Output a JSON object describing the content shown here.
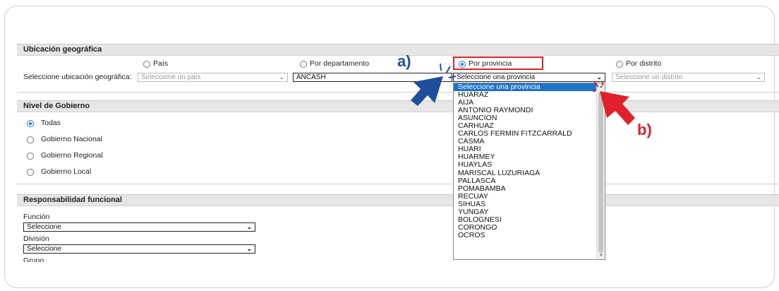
{
  "ubicacion": {
    "header": "Ubicación geográfica",
    "radios": [
      {
        "label": "País",
        "checked": false
      },
      {
        "label": "Por departamento",
        "checked": false
      },
      {
        "label": "Por provincia",
        "checked": true
      },
      {
        "label": "Por distrito",
        "checked": false
      }
    ],
    "prompt": "Seleccione ubicación geográfica:",
    "pais_select": "Seleccione un país",
    "departamento_select": "ANCASH",
    "provincia_select": "Seleccione una provincia",
    "distrito_select": "Seleccione un distrito"
  },
  "provincia_options": [
    "Seleccione una provincia",
    "HUARAZ",
    "AIJA",
    "ANTONIO RAYMONDI",
    "ASUNCION",
    "CARHUAZ",
    "CARLOS FERMIN FITZCARRALD",
    "CASMA",
    "HUARI",
    "HUARMEY",
    "HUAYLAS",
    "MARISCAL LUZURIAGA",
    "PALLASCA",
    "POMABAMBA",
    "RECUAY",
    "SIHUAS",
    "YUNGAY",
    "BOLOGNESI",
    "CORONGO",
    "OCROS"
  ],
  "nivel": {
    "header": "Nivel de Gobierno",
    "options": [
      {
        "label": "Todas",
        "checked": true
      },
      {
        "label": "Gobierno Nacional",
        "checked": false
      },
      {
        "label": "Gobierno Regional",
        "checked": false
      },
      {
        "label": "Gobierno Local",
        "checked": false
      }
    ]
  },
  "responsabilidad": {
    "header": "Responsabilidad funcional",
    "funcion_label": "Función",
    "funcion_select": "Seleccione",
    "division_label": "División",
    "division_select": "Seleccione",
    "grupo_label": "Grupo"
  },
  "annotations": {
    "a": "a)",
    "b": "b)"
  },
  "colors": {
    "accent": "#1a73e8",
    "highlight_box": "#e32222",
    "arrow_a": "#1f4f9a",
    "arrow_b": "#e0202a",
    "selected_option": "#1e73c8"
  }
}
